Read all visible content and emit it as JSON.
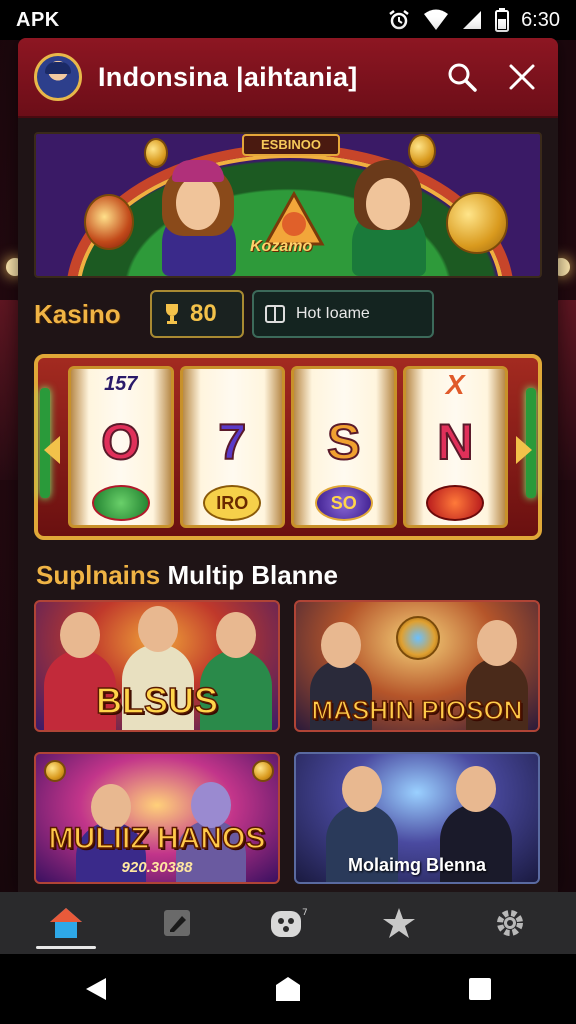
{
  "status_bar": {
    "carrier": "APK",
    "time": "6:30"
  },
  "header": {
    "title": "Indonsina |aihtania]",
    "search_icon": "search-icon",
    "close_icon": "close-icon"
  },
  "hero": {
    "label": "ESBINOO",
    "logo_text": "Kozamo"
  },
  "kasino": {
    "label": "Kasino",
    "balance": "80",
    "hot_label": "Hot Ioame"
  },
  "slot": {
    "reels": [
      {
        "top": "157",
        "mid": "O",
        "bottom": ""
      },
      {
        "top": "",
        "mid": "7",
        "bottom": "IRO"
      },
      {
        "top": "",
        "mid": "S",
        "bottom": "SO"
      },
      {
        "top": "X",
        "mid": "N",
        "bottom": ""
      }
    ]
  },
  "section": {
    "title_accent": "Suplnains",
    "title_rest": " Multip Blanne"
  },
  "cards": [
    {
      "title": "BLSUS"
    },
    {
      "title": "MASHIN PIOSON"
    },
    {
      "title": "MULIIZ HANOS",
      "subtitle": "920.30388"
    },
    {
      "title": "Molaimg Blenna"
    }
  ],
  "bottom_nav": {
    "items": [
      "home-icon",
      "edit-icon",
      "games-icon",
      "star-icon",
      "settings-icon"
    ],
    "active": "home-icon"
  },
  "colors": {
    "accent_gold": "#f0b445",
    "header_red": "#8d1622",
    "nav_active": "#2ea8e8"
  }
}
